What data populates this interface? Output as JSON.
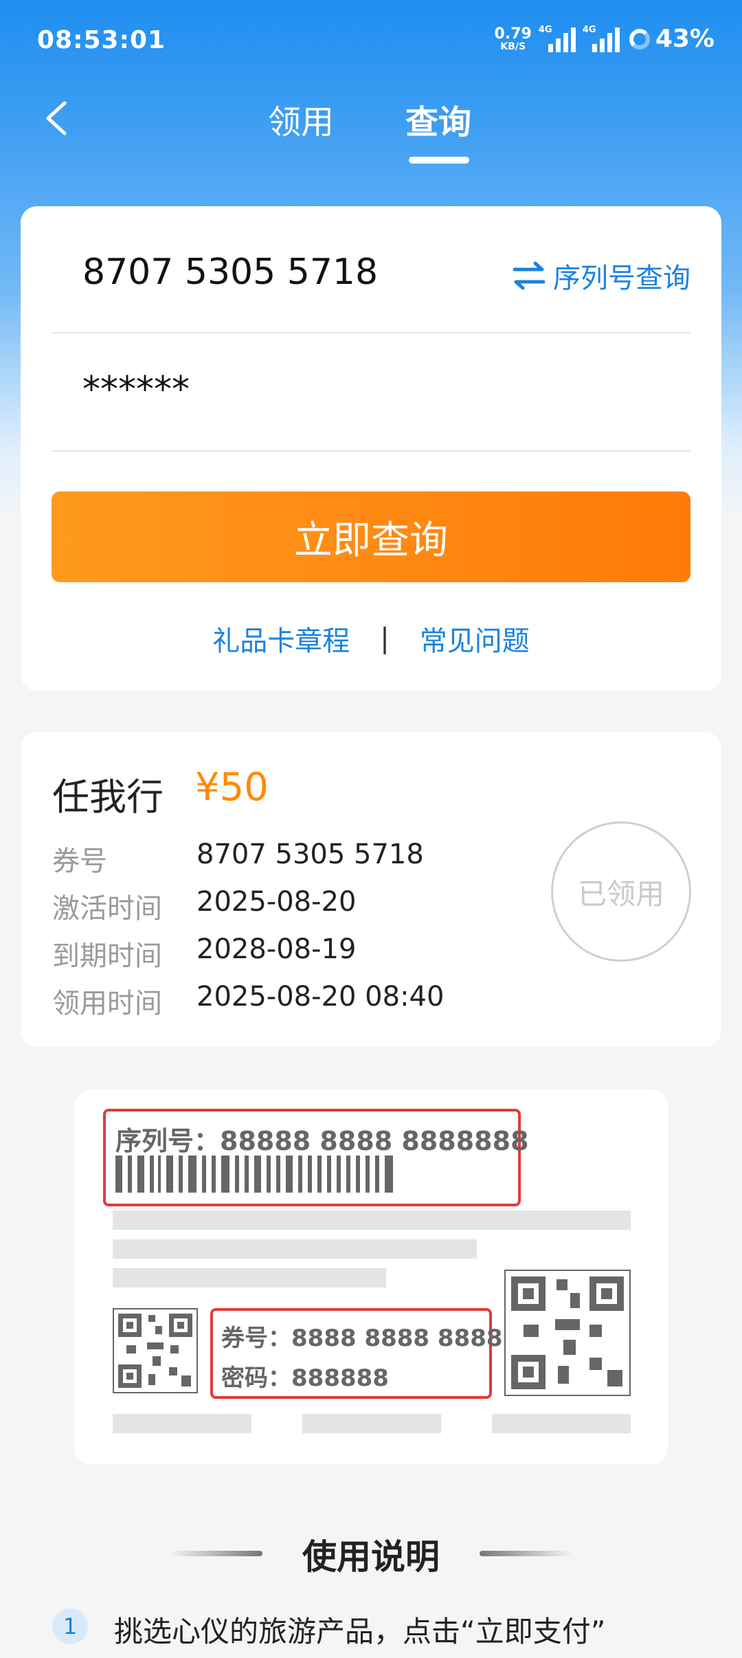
{
  "status_bar": {
    "time": "08:53:01",
    "net_speed": "0.79",
    "net_unit": "KB/S",
    "signal1_label": "4G",
    "signal2_label": "4G",
    "battery": "43%"
  },
  "nav": {
    "back_icon": "chevron-left-icon",
    "tabs": [
      {
        "label": "领用",
        "active": false
      },
      {
        "label": "查询",
        "active": true
      }
    ]
  },
  "query": {
    "card_number": "8707 5305 5718",
    "password": "******",
    "serial_link_label": "序列号查询",
    "serial_link_icon": "swap-arrows-icon",
    "submit_label": "立即查询",
    "rules_link": "礼品卡章程",
    "separator": "|",
    "faq_link": "常见问题"
  },
  "result": {
    "name": "任我行",
    "price": "¥50",
    "rows": [
      {
        "key": "券号",
        "value": "8707 5305 5718"
      },
      {
        "key": "激活时间",
        "value": "2025-08-20"
      },
      {
        "key": "到期时间",
        "value": "2028-08-19"
      },
      {
        "key": "领用时间",
        "value": "2025-08-20 08:40"
      }
    ],
    "stamp": "已领用"
  },
  "sample_card": {
    "serial_text": "序列号：88888 8888 8888888",
    "coupon_text": "券号：8888 8888 8888",
    "password_text": "密码：888888"
  },
  "instructions": {
    "title": "使用说明",
    "steps": [
      {
        "num": "1",
        "text": "挑选心仪的旅游产品，点击“立即支付”"
      }
    ]
  },
  "colors": {
    "accent_blue": "#1a82e0",
    "accent_orange": "#ff8a00",
    "highlight_red": "#e23a3a"
  }
}
